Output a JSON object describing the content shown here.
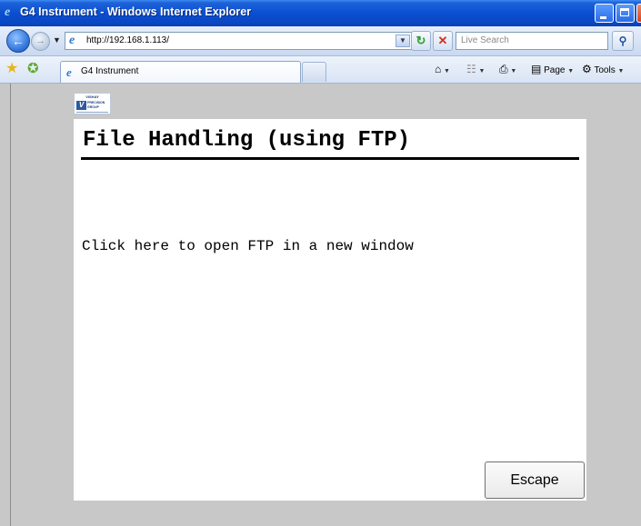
{
  "window": {
    "title": "G4 Instrument - Windows Internet Explorer"
  },
  "address_bar": {
    "url": "http://192.168.1.113/",
    "search_placeholder": "Live Search"
  },
  "tabs": [
    {
      "label": "G4 Instrument",
      "active": true
    }
  ],
  "command_bar": {
    "page_label": "Page",
    "tools_label": "Tools"
  },
  "logo": {
    "top_text": "VISHAY",
    "sub_text_1": "PRECISION",
    "sub_text_2": "GROUP",
    "mark": "V"
  },
  "page": {
    "title": "File Handling (using FTP)",
    "ftp_link": "Click here to open FTP in a new window",
    "escape_label": "Escape"
  },
  "colors": {
    "titlebar": "#0a4fd0",
    "content_bg": "#c8c8c8",
    "panel_bg": "#ffffff"
  }
}
